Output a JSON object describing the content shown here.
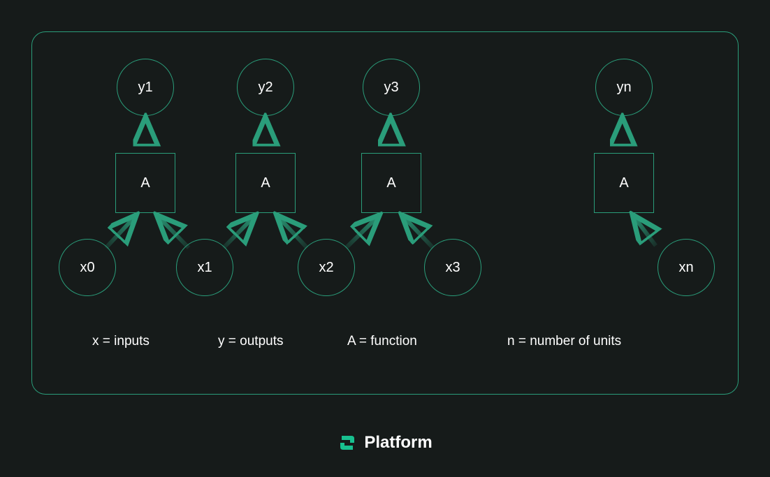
{
  "outputs": {
    "y1": "y1",
    "y2": "y2",
    "y3": "y3",
    "yn": "yn"
  },
  "functions": {
    "a1": "A",
    "a2": "A",
    "a3": "A",
    "an": "A"
  },
  "inputs": {
    "x0": "x0",
    "x1": "x1",
    "x2": "x2",
    "x3": "x3",
    "xn": "xn"
  },
  "legend": {
    "x": "x = inputs",
    "y": "y = outputs",
    "a": "A = function",
    "n": "n = number of units"
  },
  "brand": {
    "name": "Platform"
  }
}
